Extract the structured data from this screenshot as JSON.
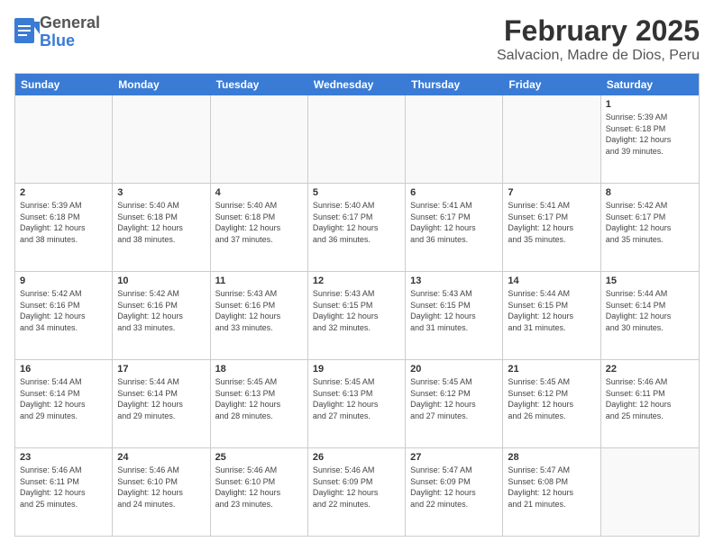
{
  "logo": {
    "general": "General",
    "blue": "Blue"
  },
  "header": {
    "title": "February 2025",
    "subtitle": "Salvacion, Madre de Dios, Peru"
  },
  "weekdays": [
    "Sunday",
    "Monday",
    "Tuesday",
    "Wednesday",
    "Thursday",
    "Friday",
    "Saturday"
  ],
  "weeks": [
    [
      {
        "day": "",
        "info": ""
      },
      {
        "day": "",
        "info": ""
      },
      {
        "day": "",
        "info": ""
      },
      {
        "day": "",
        "info": ""
      },
      {
        "day": "",
        "info": ""
      },
      {
        "day": "",
        "info": ""
      },
      {
        "day": "1",
        "info": "Sunrise: 5:39 AM\nSunset: 6:18 PM\nDaylight: 12 hours\nand 39 minutes."
      }
    ],
    [
      {
        "day": "2",
        "info": "Sunrise: 5:39 AM\nSunset: 6:18 PM\nDaylight: 12 hours\nand 38 minutes."
      },
      {
        "day": "3",
        "info": "Sunrise: 5:40 AM\nSunset: 6:18 PM\nDaylight: 12 hours\nand 38 minutes."
      },
      {
        "day": "4",
        "info": "Sunrise: 5:40 AM\nSunset: 6:18 PM\nDaylight: 12 hours\nand 37 minutes."
      },
      {
        "day": "5",
        "info": "Sunrise: 5:40 AM\nSunset: 6:17 PM\nDaylight: 12 hours\nand 36 minutes."
      },
      {
        "day": "6",
        "info": "Sunrise: 5:41 AM\nSunset: 6:17 PM\nDaylight: 12 hours\nand 36 minutes."
      },
      {
        "day": "7",
        "info": "Sunrise: 5:41 AM\nSunset: 6:17 PM\nDaylight: 12 hours\nand 35 minutes."
      },
      {
        "day": "8",
        "info": "Sunrise: 5:42 AM\nSunset: 6:17 PM\nDaylight: 12 hours\nand 35 minutes."
      }
    ],
    [
      {
        "day": "9",
        "info": "Sunrise: 5:42 AM\nSunset: 6:16 PM\nDaylight: 12 hours\nand 34 minutes."
      },
      {
        "day": "10",
        "info": "Sunrise: 5:42 AM\nSunset: 6:16 PM\nDaylight: 12 hours\nand 33 minutes."
      },
      {
        "day": "11",
        "info": "Sunrise: 5:43 AM\nSunset: 6:16 PM\nDaylight: 12 hours\nand 33 minutes."
      },
      {
        "day": "12",
        "info": "Sunrise: 5:43 AM\nSunset: 6:15 PM\nDaylight: 12 hours\nand 32 minutes."
      },
      {
        "day": "13",
        "info": "Sunrise: 5:43 AM\nSunset: 6:15 PM\nDaylight: 12 hours\nand 31 minutes."
      },
      {
        "day": "14",
        "info": "Sunrise: 5:44 AM\nSunset: 6:15 PM\nDaylight: 12 hours\nand 31 minutes."
      },
      {
        "day": "15",
        "info": "Sunrise: 5:44 AM\nSunset: 6:14 PM\nDaylight: 12 hours\nand 30 minutes."
      }
    ],
    [
      {
        "day": "16",
        "info": "Sunrise: 5:44 AM\nSunset: 6:14 PM\nDaylight: 12 hours\nand 29 minutes."
      },
      {
        "day": "17",
        "info": "Sunrise: 5:44 AM\nSunset: 6:14 PM\nDaylight: 12 hours\nand 29 minutes."
      },
      {
        "day": "18",
        "info": "Sunrise: 5:45 AM\nSunset: 6:13 PM\nDaylight: 12 hours\nand 28 minutes."
      },
      {
        "day": "19",
        "info": "Sunrise: 5:45 AM\nSunset: 6:13 PM\nDaylight: 12 hours\nand 27 minutes."
      },
      {
        "day": "20",
        "info": "Sunrise: 5:45 AM\nSunset: 6:12 PM\nDaylight: 12 hours\nand 27 minutes."
      },
      {
        "day": "21",
        "info": "Sunrise: 5:45 AM\nSunset: 6:12 PM\nDaylight: 12 hours\nand 26 minutes."
      },
      {
        "day": "22",
        "info": "Sunrise: 5:46 AM\nSunset: 6:11 PM\nDaylight: 12 hours\nand 25 minutes."
      }
    ],
    [
      {
        "day": "23",
        "info": "Sunrise: 5:46 AM\nSunset: 6:11 PM\nDaylight: 12 hours\nand 25 minutes."
      },
      {
        "day": "24",
        "info": "Sunrise: 5:46 AM\nSunset: 6:10 PM\nDaylight: 12 hours\nand 24 minutes."
      },
      {
        "day": "25",
        "info": "Sunrise: 5:46 AM\nSunset: 6:10 PM\nDaylight: 12 hours\nand 23 minutes."
      },
      {
        "day": "26",
        "info": "Sunrise: 5:46 AM\nSunset: 6:09 PM\nDaylight: 12 hours\nand 22 minutes."
      },
      {
        "day": "27",
        "info": "Sunrise: 5:47 AM\nSunset: 6:09 PM\nDaylight: 12 hours\nand 22 minutes."
      },
      {
        "day": "28",
        "info": "Sunrise: 5:47 AM\nSunset: 6:08 PM\nDaylight: 12 hours\nand 21 minutes."
      },
      {
        "day": "",
        "info": ""
      }
    ]
  ]
}
